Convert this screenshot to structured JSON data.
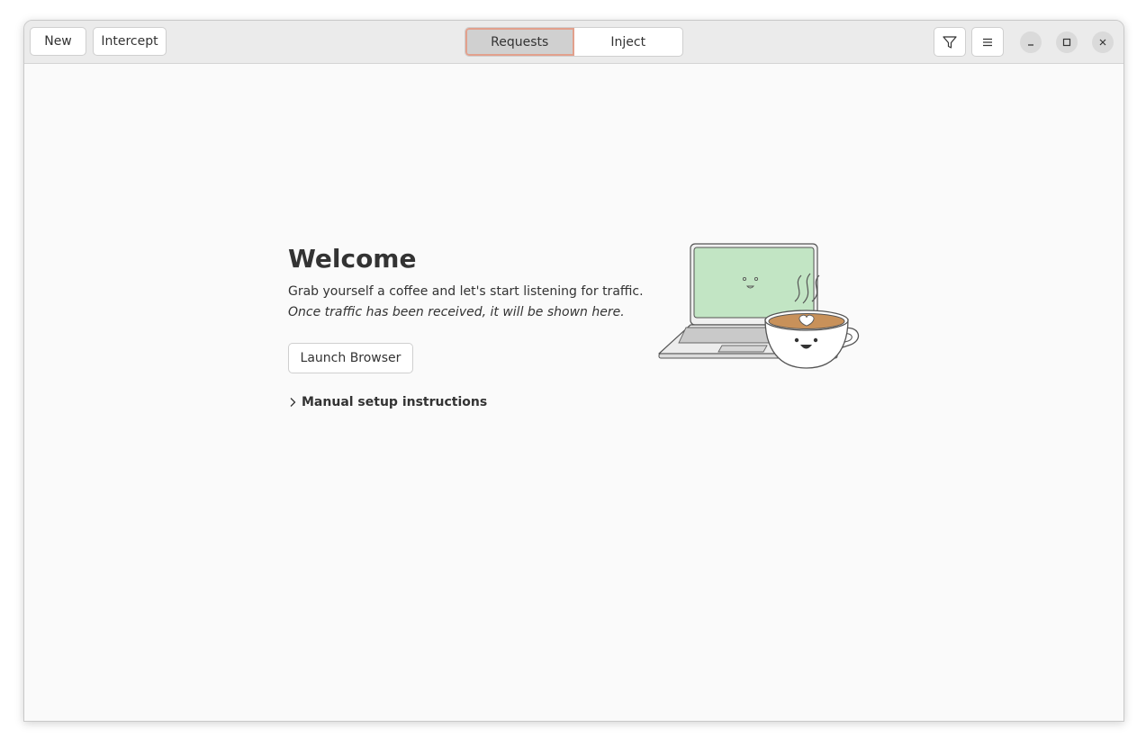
{
  "header": {
    "new_label": "New",
    "intercept_label": "Intercept",
    "tabs": [
      {
        "label": "Requests",
        "active": true
      },
      {
        "label": "Inject",
        "active": false
      }
    ],
    "icons": {
      "filter": "filter-icon",
      "menu": "hamburger-menu-icon",
      "minimize": "minimize-icon",
      "maximize": "maximize-icon",
      "close": "close-icon"
    }
  },
  "main": {
    "title": "Welcome",
    "subtitle": "Grab yourself a coffee and let's start listening for traffic.",
    "note": "Once traffic has been received, it will be shown here.",
    "launch_label": "Launch Browser",
    "manual_label": "Manual setup instructions"
  },
  "colors": {
    "accent_outline": "#e2a08c",
    "screen_green": "#c2e5c4",
    "coffee": "#c8915a"
  }
}
